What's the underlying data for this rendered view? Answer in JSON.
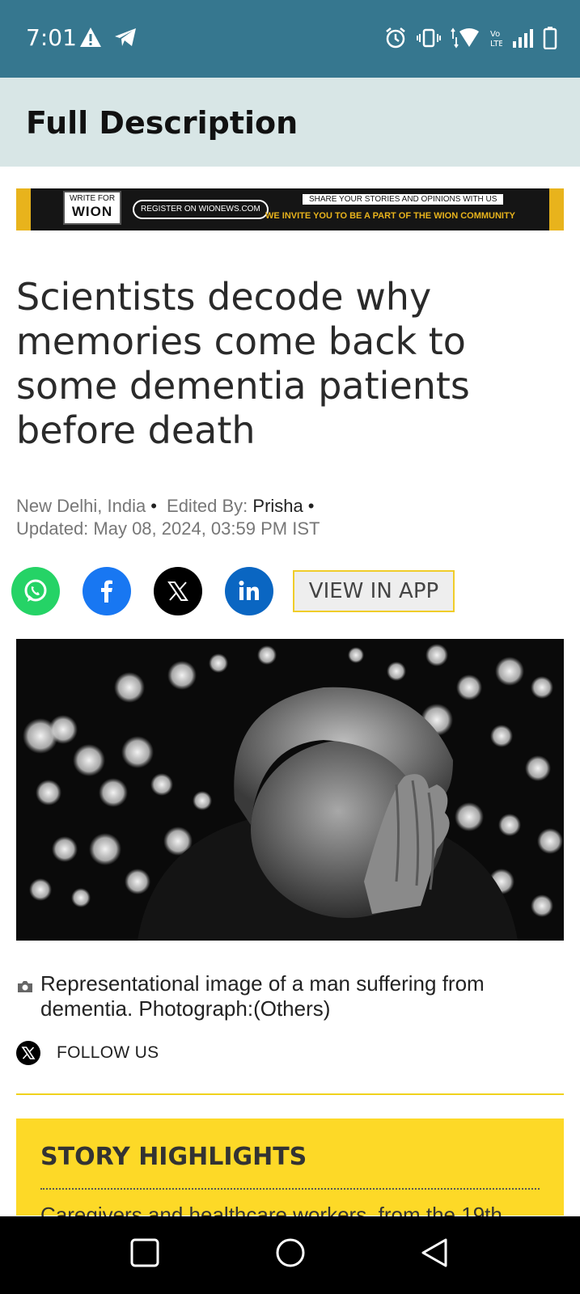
{
  "status_bar": {
    "time": "7:01",
    "icons_left": [
      "warning-icon",
      "telegram-icon"
    ],
    "icons_right": [
      "alarm-icon",
      "vibrate-icon",
      "wifi-icon",
      "volte-icon",
      "signal-icon",
      "battery-icon"
    ]
  },
  "header": {
    "title": "Full Description"
  },
  "banner": {
    "logo_line1": "WRITE FOR",
    "logo_line2": "WION",
    "register": "REGISTER ON WIONEWS.COM",
    "share": "SHARE YOUR STORIES AND OPINIONS WITH US",
    "invite": "WE INVITE YOU TO BE A PART OF THE WION COMMUNITY"
  },
  "article": {
    "headline": "Scientists decode why memories come back to some dementia patients before death",
    "location": "New Delhi, India",
    "edited_by_label": "Edited By:",
    "editor": "Prisha",
    "updated": "Updated: May 08, 2024, 03:59 PM IST",
    "caption": "Representational image of a man suffering from dementia. Photograph:(Others)"
  },
  "share": {
    "buttons": [
      "whatsapp-icon",
      "facebook-icon",
      "x-icon",
      "linkedin-icon"
    ],
    "view_in_app": "VIEW IN APP"
  },
  "follow": {
    "label": "FOLLOW US"
  },
  "highlights": {
    "title": "STORY HIGHLIGHTS",
    "first_line": "Caregivers and healthcare workers, from the 19th"
  },
  "colors": {
    "status_bar": "#36778f",
    "header_bg": "#d8e6e6",
    "highlight_bg": "#fdd927",
    "whatsapp": "#25d366",
    "facebook": "#1877f2",
    "linkedin": "#0a66c2"
  }
}
